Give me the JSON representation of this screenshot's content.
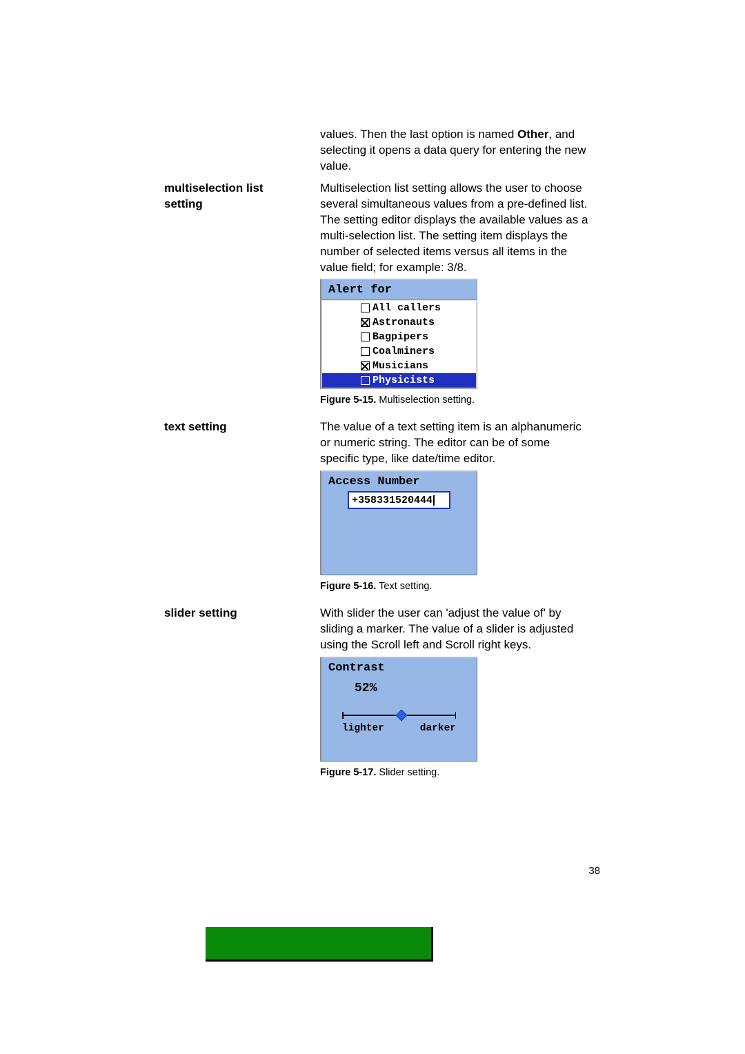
{
  "intro": {
    "text_pre": "values. Then the last option is named ",
    "text_bold": "Other",
    "text_post": ", and selecting it opens a data query for entering the new value."
  },
  "multisel": {
    "label": "multiselection list setting",
    "desc": "Multiselection list setting allows the user to choose several simultaneous values from a pre-defined list. The setting editor displays the available values as a multi-selection list.  The setting item displays the number of selected items versus all items in the value field; for example: 3/8.",
    "header": "Alert for",
    "items": [
      {
        "label": "All callers",
        "checked": false,
        "selected": false
      },
      {
        "label": "Astronauts",
        "checked": true,
        "selected": false
      },
      {
        "label": "Bagpipers",
        "checked": false,
        "selected": false
      },
      {
        "label": "Coalminers",
        "checked": false,
        "selected": false
      },
      {
        "label": "Musicians",
        "checked": true,
        "selected": false
      },
      {
        "label": "Physicists",
        "checked": false,
        "selected": true
      }
    ],
    "caption_bold": "Figure 5-15.",
    "caption_rest": " Multiselection setting."
  },
  "textset": {
    "label": "text setting",
    "desc": "The value of a text setting item is an alphanumeric or numeric string. The editor can be of some specific type, like date/time editor.",
    "header": "Access Number",
    "value": "+358331520444",
    "caption_bold": "Figure 5-16.",
    "caption_rest": " Text setting."
  },
  "sliderset": {
    "label": "slider setting",
    "desc": "With slider the user can 'adjust the value of' by sliding a marker. The value of a slider is adjusted using the Scroll left and Scroll right keys.",
    "header": "Contrast",
    "value_pct": 52,
    "value_display": "52%",
    "left_label": "lighter",
    "right_label": "darker",
    "caption_bold": "Figure 5-17.",
    "caption_rest": " Slider setting."
  },
  "page_number": "38"
}
